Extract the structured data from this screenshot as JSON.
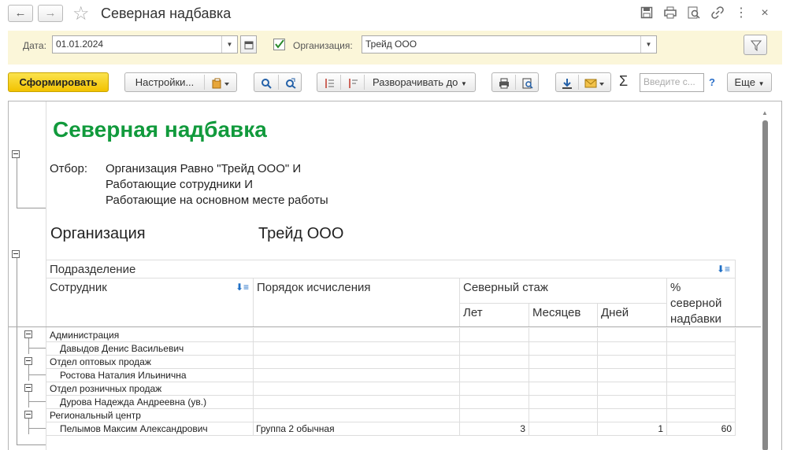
{
  "window": {
    "title": "Северная надбавка",
    "back_icon": "←",
    "forward_icon": "→",
    "star_icon": "☆",
    "menu_icon": "⋮",
    "close_icon": "×"
  },
  "filter": {
    "date_label": "Дата:",
    "date_value": "01.01.2024",
    "org_checked": true,
    "org_label": "Организация:",
    "org_value": "Трейд ООО"
  },
  "toolbar": {
    "generate": "Сформировать",
    "settings": "Настройки...",
    "expand_to": "Разворачивать до",
    "search_placeholder": "Введите с...",
    "help": "?",
    "more": "Еще"
  },
  "report": {
    "title": "Северная надбавка",
    "filter_label": "Отбор:",
    "filter_lines": [
      "Организация Равно \"Трейд ООО\" И",
      "Работающие сотрудники И",
      "Работающие на основном месте работы"
    ],
    "org_label": "Организация",
    "org_value": "Трейд ООО",
    "headers": {
      "department": "Подразделение",
      "employee": "Сотрудник",
      "calc_order": "Порядок исчисления",
      "north_exp": "Северный стаж",
      "years": "Лет",
      "months": "Месяцев",
      "days": "Дней",
      "percent_1": "%",
      "percent_2": "северной",
      "percent_3": "надбавки"
    },
    "rows": [
      {
        "type": "group",
        "name": "Администрация"
      },
      {
        "type": "item",
        "name": "Давыдов Денис Васильевич",
        "order": "",
        "years": "",
        "months": "",
        "days": "",
        "percent": ""
      },
      {
        "type": "group",
        "name": "Отдел оптовых продаж"
      },
      {
        "type": "item",
        "name": "Ростова Наталия Ильинична",
        "order": "",
        "years": "",
        "months": "",
        "days": "",
        "percent": ""
      },
      {
        "type": "group",
        "name": "Отдел розничных продаж"
      },
      {
        "type": "item",
        "name": "Дурова Надежда Андреевна (ув.)",
        "order": "",
        "years": "",
        "months": "",
        "days": "",
        "percent": ""
      },
      {
        "type": "group",
        "name": "Региональный центр"
      },
      {
        "type": "item",
        "name": "Пелымов Максим Александрович",
        "order": "Группа 2 обычная",
        "years": "3",
        "months": "",
        "days": "1",
        "percent": "60"
      }
    ]
  }
}
